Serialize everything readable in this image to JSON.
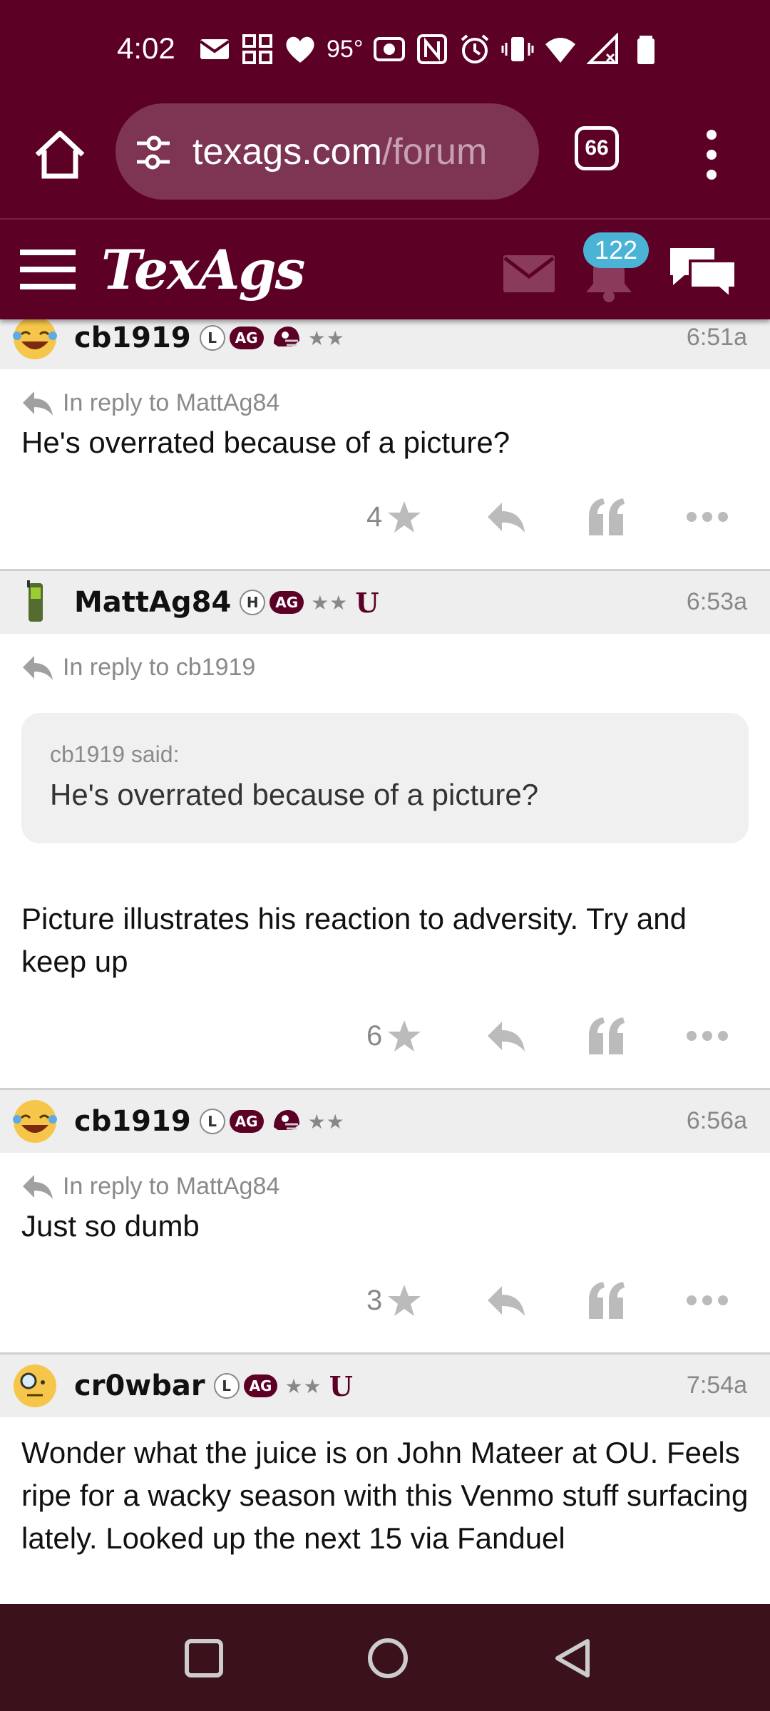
{
  "status_bar": {
    "time": "4:02",
    "temperature": "95°",
    "icons": [
      "mail-icon",
      "grid-icon",
      "heart-icon",
      "camera-icon",
      "nfc-icon",
      "alarm-icon",
      "vibrate-icon",
      "wifi-icon",
      "signal-icon",
      "battery-icon"
    ]
  },
  "browser": {
    "url_domain": "texags.com",
    "url_path": "/forum",
    "tab_count": "66"
  },
  "site_header": {
    "logo": "TexAgs",
    "notification_count": "122",
    "colors": {
      "brand": "#5c0025",
      "badge": "#4bb3d6"
    }
  },
  "posts": [
    {
      "username": "cb1919",
      "level_badge": "L",
      "ag_badge": "AG",
      "stars": "★★",
      "time": "6:51a",
      "reply_to": "In reply to MattAg84",
      "text": "He's overrated because of a picture?",
      "score": "4"
    },
    {
      "username": "MattAg84",
      "level_badge": "H",
      "ag_badge": "AG",
      "stars": "★★",
      "u_badge": "U",
      "time": "6:53a",
      "reply_to": "In reply to cb1919",
      "quote_by": "cb1919 said:",
      "quote_text": "He's overrated because of a picture?",
      "text": "Picture illustrates his reaction to adversity. Try and keep up",
      "score": "6"
    },
    {
      "username": "cb1919",
      "level_badge": "L",
      "ag_badge": "AG",
      "stars": "★★",
      "time": "6:56a",
      "reply_to": "In reply to MattAg84",
      "text": "Just so dumb",
      "score": "3"
    },
    {
      "username": "cr0wbar",
      "level_badge": "L",
      "ag_badge": "AG",
      "stars": "★★",
      "u_badge": "U",
      "time": "7:54a",
      "text": "Wonder what the juice is on John Mateer at OU. Feels ripe for a wacky season with this Venmo stuff surfacing lately. Looked up the next 15 via Fanduel"
    }
  ]
}
